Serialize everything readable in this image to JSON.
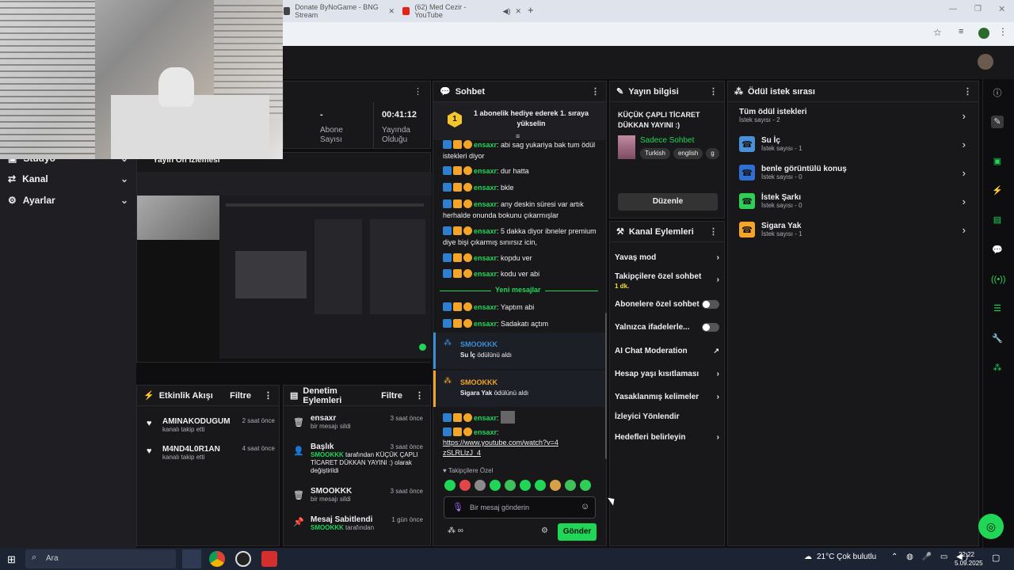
{
  "browser": {
    "tabs": [
      {
        "title": "Donate ByNoGame - BNG Stream",
        "icon": "bng-icon"
      },
      {
        "title": "(62) Med Cezir - YouTube",
        "icon": "youtube-icon"
      }
    ]
  },
  "sidebar": {
    "items": [
      {
        "label": "Stüdyo",
        "icon": "studio-icon"
      },
      {
        "label": "Kanal",
        "icon": "channel-icon"
      },
      {
        "label": "Ayarlar",
        "icon": "gear-icon"
      }
    ]
  },
  "stats": [
    {
      "value": "-",
      "label": "Abone Sayısı"
    },
    {
      "value": "00:41:12",
      "label": "Yayında Olduğu"
    }
  ],
  "preview": {
    "title": "Yayın Ön İzlemesi"
  },
  "chat": {
    "title": "Sohbet",
    "pinned": {
      "rank": "1",
      "text": "1 abonelik hediye ederek 1. sıraya yükselin"
    },
    "messages": [
      {
        "user": "ensaxr",
        "text": "abi sag yukariya bak tum ödül istekleri diyor"
      },
      {
        "user": "ensaxr",
        "text": "dur hatta"
      },
      {
        "user": "ensaxr",
        "text": "bkle"
      },
      {
        "user": "ensaxr",
        "text": "any deskin süresi var artık herhalde onunda bokunu çıkarmışlar"
      },
      {
        "user": "ensaxr",
        "text": "5 dakka diyor ibneler premium diye bişi çıkarmış sınırsız icin,"
      },
      {
        "user": "ensaxr",
        "text": "kopdu ver"
      },
      {
        "user": "ensaxr",
        "text": "kodu ver abi"
      }
    ],
    "new_messages_label": "Yeni mesajlar",
    "messages_after": [
      {
        "user": "ensaxr",
        "text": "Yaptım abi"
      },
      {
        "user": "ensaxr",
        "text": "Sadakatı açtım"
      }
    ],
    "redemptions": [
      {
        "user": "SMOOKKK",
        "reward": "Su İç",
        "suffix": "ödülünü aldı",
        "color": "#3a8fd9"
      },
      {
        "user": "SMOOKKK",
        "reward": "Sigara Yak",
        "suffix": "ödülünü aldı",
        "color": "#f3a52a"
      }
    ],
    "last_user": "ensaxr",
    "link_user": "ensaxr",
    "link": "https://www.youtube.com/watch?v=4zSLRLlzJ_4",
    "followers_only": "Takipçilere Özel",
    "input_placeholder": "Bir mesaj gönderin",
    "send_label": "Gönder",
    "points": "∞"
  },
  "stream_info": {
    "title": "Yayın bilgisi",
    "stream_title": "KÜÇÜK ÇAPLI TİCARET DÜKKAN YAYINI :)",
    "category": "Sadece Sohbet",
    "tags": [
      "Turkish",
      "english",
      "g"
    ],
    "edit_label": "Düzenle"
  },
  "channel_actions": {
    "title": "Kanal Eylemleri",
    "items": [
      {
        "label": "Yavaş mod",
        "control": "chevron"
      },
      {
        "label": "Takipçilere özel sohbet",
        "sub": "1 dk.",
        "control": "chevron"
      },
      {
        "label": "Abonelere özel sohbet",
        "control": "toggle"
      },
      {
        "label": "Yalnızca ifadelerle...",
        "control": "toggle"
      },
      {
        "label": "AI Chat Moderation",
        "control": "external"
      },
      {
        "label": "Hesap yaşı kısıtlaması",
        "control": "chevron"
      },
      {
        "label": "Yasaklanmış kelimeler",
        "control": "chevron"
      },
      {
        "label": "İzleyici Yönlendir",
        "control": "none"
      },
      {
        "label": "Hedefleri belirleyin",
        "control": "chevron"
      }
    ]
  },
  "rewards": {
    "title": "Ödül istek sırası",
    "all": {
      "title": "Tüm ödül istekleri",
      "sub": "İstek sayısı - 2"
    },
    "items": [
      {
        "title": "Su İç",
        "sub": "İstek sayısı - 1",
        "color": "#4a90d9"
      },
      {
        "title": "benle görüntülü konuş",
        "sub": "İstek sayısı - 0",
        "color": "#2f6fd1"
      },
      {
        "title": "İstek Şarkı",
        "sub": "İstek sayısı - 0",
        "color": "#2fcf57"
      },
      {
        "title": "Sigara Yak",
        "sub": "İstek sayısı - 1",
        "color": "#f3a52a"
      }
    ]
  },
  "activity": {
    "title": "Etkinlik Akışı",
    "filter": "Filtre",
    "items": [
      {
        "name": "AMINAKODUGUM",
        "sub": "kanalı takip etti",
        "time": "2 saat önce"
      },
      {
        "name": "M4ND4L0R1AN",
        "sub": "kanalı takip etti",
        "time": "4 saat önce"
      }
    ]
  },
  "moderation": {
    "title": "Denetim Eylemleri",
    "filter": "Filtre",
    "items": [
      {
        "name": "ensaxr",
        "sub": "bir mesajı sildi",
        "time": "3 saat önce"
      },
      {
        "name": "Başlık",
        "user": "SMOOKKK",
        "sub": "tarafından KÜÇÜK ÇAPLI TİCARET DÜKKAN YAYINI :) olarak değiştirildi",
        "time": "3 saat önce"
      },
      {
        "name": "SMOOKKK",
        "sub": "bir mesajı sildi",
        "time": "3 saat önce"
      },
      {
        "name": "Mesaj Sabitlendi",
        "user": "SMOOKKK",
        "sub": "tarafından",
        "time": "1 gün önce"
      }
    ]
  },
  "taskbar": {
    "search": "Ara",
    "weather": "21°C  Çok bulutlu",
    "time": "22:22",
    "date": "5.09.2025"
  },
  "colors": {
    "accent": "#1fd657",
    "bg": "#0e0e10",
    "panel": "#18181b"
  }
}
